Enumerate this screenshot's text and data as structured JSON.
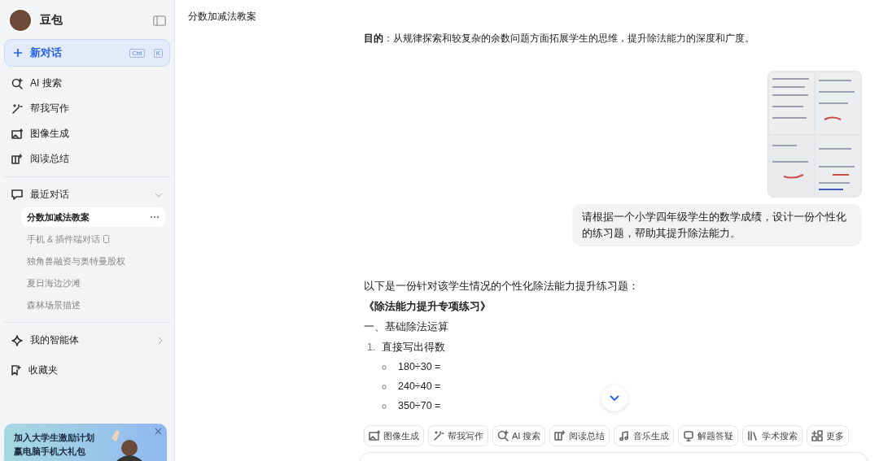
{
  "sidebar": {
    "app_name": "豆包",
    "new_chat": {
      "label": "新对话",
      "keys": [
        "Ctrl",
        "K"
      ]
    },
    "nav": [
      {
        "label": "AI 搜索"
      },
      {
        "label": "帮我写作"
      },
      {
        "label": "图像生成"
      },
      {
        "label": "阅读总结"
      }
    ],
    "recent": {
      "label": "最近对话",
      "expanded": true,
      "items": [
        {
          "label": "分数加减法教案",
          "selected": true,
          "kind": "plain"
        },
        {
          "label": "手机 & 插件端对话",
          "selected": false,
          "kind": "device"
        },
        {
          "label": "独角兽融资与奥特曼股权",
          "selected": false,
          "kind": "plain"
        },
        {
          "label": "夏日海边沙滩",
          "selected": false,
          "kind": "plain"
        },
        {
          "label": "森林场景描述",
          "selected": false,
          "kind": "plain"
        }
      ]
    },
    "agents": {
      "label": "我的智能体"
    },
    "favorites": {
      "label": "收藏夹"
    },
    "promo": {
      "lines": [
        "加入大学生激励计划",
        "赢电脑手机大礼包"
      ]
    }
  },
  "main": {
    "title": "分数加减法教案",
    "goal": "**目的**：从规律探索和较复杂的余数问题方面拓展学生的思维，提升除法能力的深度和广度。",
    "user_message": "请根据一个小学四年级学生的数学成绩，设计一份个性化的练习题，帮助其提升除法能力。",
    "reply": {
      "intro": "以下是一份针对该学生情况的个性化除法能力提升练习题：",
      "heading": "《除法能力提升专项练习》",
      "section": "一、基础除法运算",
      "list": [
        {
          "number": "1.",
          "text": "直接写出得数",
          "bullets": [
            "180÷30 =",
            "240÷40 =",
            "350÷70 ="
          ]
        }
      ]
    },
    "tools": [
      {
        "label": "图像生成"
      },
      {
        "label": "帮我写作"
      },
      {
        "label": "AI 搜索"
      },
      {
        "label": "阅读总结"
      },
      {
        "label": "音乐生成"
      },
      {
        "label": "解题答疑"
      },
      {
        "label": "学术搜索"
      },
      {
        "label": "更多"
      }
    ]
  }
}
